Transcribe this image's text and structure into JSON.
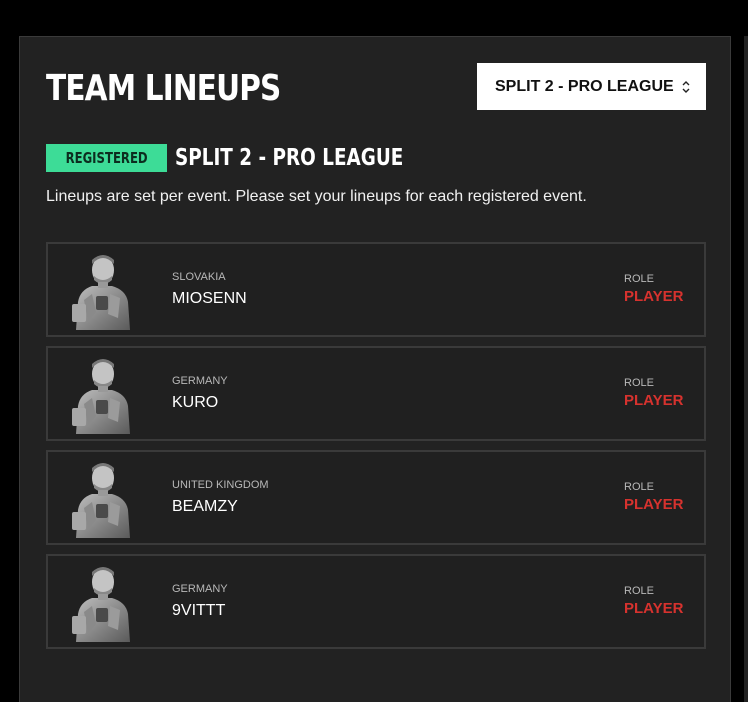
{
  "page": {
    "title": "TEAM LINEUPS",
    "event_select": {
      "value": "SPLIT 2 - PRO LEAGUE",
      "icon": "chevron-updown-icon"
    }
  },
  "event": {
    "badge": "REGISTERED",
    "badge_color": "#3ddc97",
    "name": "SPLIT 2 - PRO LEAGUE",
    "intro": "Lineups are set per event. Please set your lineups for each registered event."
  },
  "players": [
    {
      "country": "SLOVAKIA",
      "name": "MIOSENN",
      "role_label": "ROLE",
      "role": "PLAYER"
    },
    {
      "country": "GERMANY",
      "name": "KURO",
      "role_label": "ROLE",
      "role": "PLAYER"
    },
    {
      "country": "UNITED KINGDOM",
      "name": "BEAMZY",
      "role_label": "ROLE",
      "role": "PLAYER"
    },
    {
      "country": "GERMANY",
      "name": "9VITTT",
      "role_label": "ROLE",
      "role": "PLAYER"
    }
  ],
  "colors": {
    "background": "#222222",
    "role_accent": "#d6322e"
  }
}
